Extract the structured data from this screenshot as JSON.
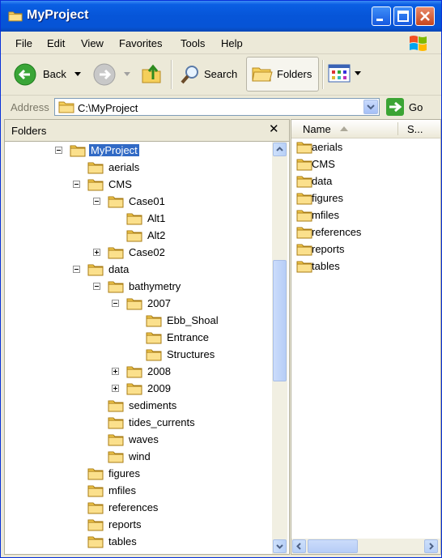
{
  "window": {
    "title": "MyProject"
  },
  "menu": [
    "File",
    "Edit",
    "View",
    "Favorites",
    "Tools",
    "Help"
  ],
  "toolbar": {
    "back_label": "Back",
    "search_label": "Search",
    "folders_label": "Folders"
  },
  "address": {
    "label": "Address",
    "value": "C:\\MyProject",
    "go_label": "Go"
  },
  "folders_pane": {
    "title": "Folders",
    "close_glyph": "✕",
    "tree": [
      {
        "label": "MyProject",
        "level": 0,
        "expander": "minus",
        "selected": true
      },
      {
        "label": "aerials",
        "level": 1,
        "expander": "none"
      },
      {
        "label": "CMS",
        "level": 1,
        "expander": "minus"
      },
      {
        "label": "Case01",
        "level": 2,
        "expander": "minus"
      },
      {
        "label": "Alt1",
        "level": 3,
        "expander": "none"
      },
      {
        "label": "Alt2",
        "level": 3,
        "expander": "none"
      },
      {
        "label": "Case02",
        "level": 2,
        "expander": "plus"
      },
      {
        "label": "data",
        "level": 1,
        "expander": "minus"
      },
      {
        "label": "bathymetry",
        "level": 2,
        "expander": "minus"
      },
      {
        "label": "2007",
        "level": 3,
        "expander": "minus"
      },
      {
        "label": "Ebb_Shoal",
        "level": 4,
        "expander": "none"
      },
      {
        "label": "Entrance",
        "level": 4,
        "expander": "none"
      },
      {
        "label": "Structures",
        "level": 4,
        "expander": "none"
      },
      {
        "label": "2008",
        "level": 3,
        "expander": "plus"
      },
      {
        "label": "2009",
        "level": 3,
        "expander": "plus"
      },
      {
        "label": "sediments",
        "level": 2,
        "expander": "none"
      },
      {
        "label": "tides_currents",
        "level": 2,
        "expander": "none"
      },
      {
        "label": "waves",
        "level": 2,
        "expander": "none"
      },
      {
        "label": "wind",
        "level": 2,
        "expander": "none"
      },
      {
        "label": "figures",
        "level": 1,
        "expander": "none"
      },
      {
        "label": "mfiles",
        "level": 1,
        "expander": "none"
      },
      {
        "label": "references",
        "level": 1,
        "expander": "none"
      },
      {
        "label": "reports",
        "level": 1,
        "expander": "none"
      },
      {
        "label": "tables",
        "level": 1,
        "expander": "none"
      }
    ]
  },
  "list_pane": {
    "columns": {
      "name": "Name",
      "size": "S..."
    },
    "items": [
      "aerials",
      "CMS",
      "data",
      "figures",
      "mfiles",
      "references",
      "reports",
      "tables"
    ]
  },
  "colors": {
    "title_blue": "#0655d8",
    "selection": "#316ac5",
    "folder_yellow": "#f5cf5a"
  }
}
